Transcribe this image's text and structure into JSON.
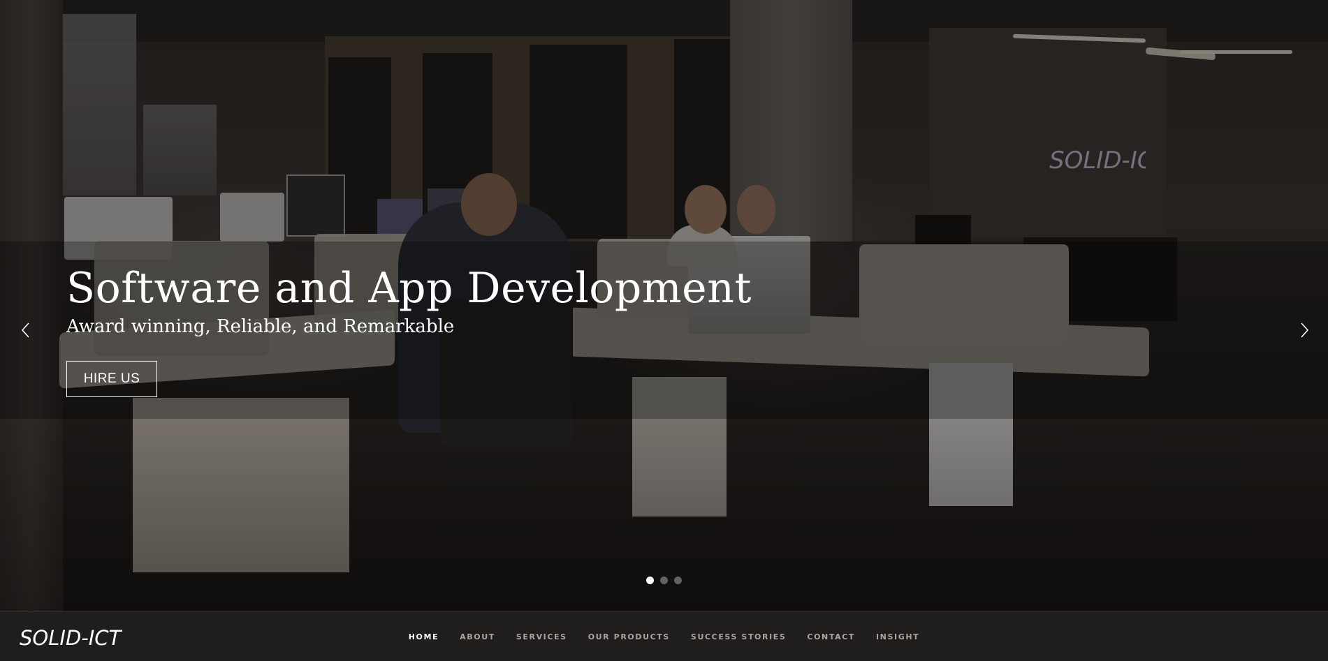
{
  "hero": {
    "title": "Software and App Development",
    "subtitle": "Award winning, Reliable, and Remarkable",
    "cta_label": "HIRE US",
    "prev_icon": "chevron-left-icon",
    "next_icon": "chevron-right-icon",
    "slides_count": 3,
    "active_slide": 1,
    "wall_logo": "SOLID-ICT"
  },
  "navbar": {
    "logo_text": "SOLID-ICT",
    "items": [
      {
        "label": "HOME",
        "active": true
      },
      {
        "label": "ABOUT",
        "active": false
      },
      {
        "label": "SERVICES",
        "active": false
      },
      {
        "label": "OUR PRODUCTS",
        "active": false
      },
      {
        "label": "SUCCESS STORIES",
        "active": false
      },
      {
        "label": "CONTACT",
        "active": false
      },
      {
        "label": "INSIGHT",
        "active": false
      }
    ]
  },
  "colors": {
    "text": "#ffffff",
    "nav_text": "#a9a4a0",
    "nav_active": "#ffffff",
    "navbar_bg": "#201e1d"
  }
}
